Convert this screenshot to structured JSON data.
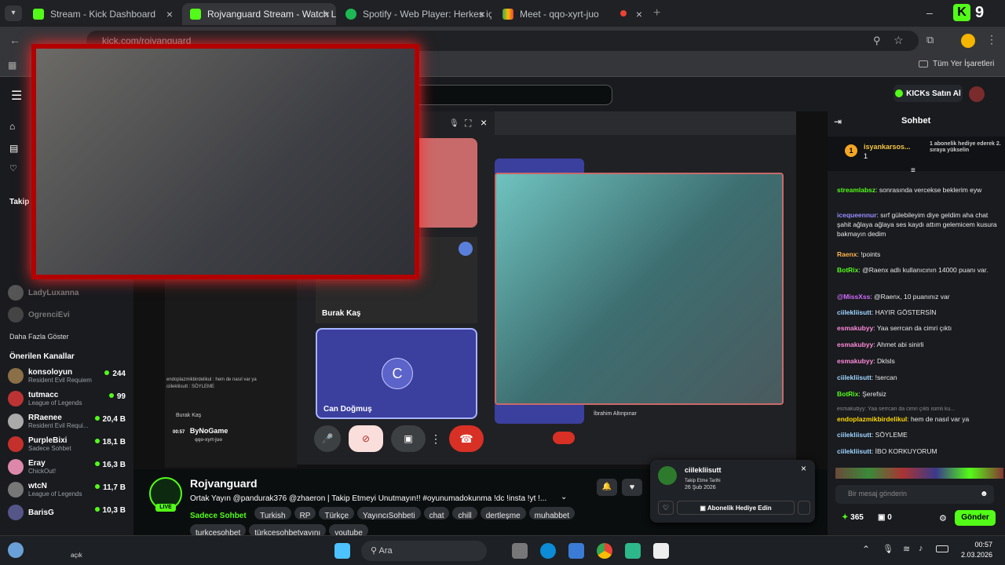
{
  "browser": {
    "tabs": [
      {
        "title": "Stream - Kick Dashboard",
        "color": "#53fc18",
        "active": false
      },
      {
        "title": "Rojvanguard Stream - Watch Li",
        "color": "#53fc18",
        "active": true
      },
      {
        "title": "Spotify - Web Player: Herkes için",
        "color": "#1db954",
        "active": false
      },
      {
        "title": "Meet - qqo-xyrt-juo",
        "color": "#34a853",
        "active": false
      }
    ],
    "url": "kick.com/rojvanguard",
    "bookmarks_label": "Tüm Yer İşaretleri",
    "kick_badge_count": "9"
  },
  "kick_nav": {
    "buy_kicks": "KICKs Satın Al"
  },
  "sidebar": {
    "following_label": "Takip",
    "followed": [
      {
        "name": "LadyLuxanna"
      },
      {
        "name": "OgrenciEvi"
      }
    ],
    "show_more": "Daha Fazla Göster",
    "recommended_title": "Önerilen Kanallar",
    "recommended": [
      {
        "name": "konsoloyun",
        "game": "Resident Evil Requiem",
        "viewers": "244",
        "color": "#8b6f47"
      },
      {
        "name": "tutmacc",
        "game": "League of Legends",
        "viewers": "99",
        "color": "#b33"
      },
      {
        "name": "RRaenee",
        "game": "Resident Evil Requi...",
        "viewers": "20,4 B",
        "color": "#aaa"
      },
      {
        "name": "PurpleBixi",
        "game": "Sadece Sohbet",
        "viewers": "18,1 B",
        "color": "#c4302b"
      },
      {
        "name": "Eray",
        "game": "ChickOut!",
        "viewers": "16,3 B",
        "color": "#d8a"
      },
      {
        "name": "wtcN",
        "game": "League of Legends",
        "viewers": "11,7 B",
        "color": "#777"
      },
      {
        "name": "BarisG",
        "game": "",
        "viewers": "10,3 B",
        "color": "#558"
      }
    ]
  },
  "call": {
    "participant_1": "Burak Kaş",
    "participant_2": "Can Doğmuş",
    "participant_2_initial": "C",
    "participant_3": "İbrahim Altınpınar",
    "mini_label": "Burak Kaş",
    "chat_overlay_1": "endoplazmikbirdelikul : hem de nasıl var ya",
    "chat_overlay_2": "ciilekliisutt : SÖYLEME",
    "watermark": "ByNoGame",
    "watermark_sub": "qqo-xyrt-juo",
    "clock": "00:57"
  },
  "channel": {
    "name": "Rojvanguard",
    "live_label": "LIVE",
    "title": "Ortak Yayın @pandurak376 @zhaeron | Takip Etmeyi Unutmayın!! #oyunumadokunma !dc !insta !yt !...",
    "category": "Sadece Sohbet",
    "tags": [
      "Turkish",
      "RP",
      "Türkçe",
      "YayıncıSohbeti",
      "chat",
      "chill",
      "dertleşme",
      "muhabbet",
      "turkçesohbet",
      "türkçesohbetyayını",
      "youtube"
    ]
  },
  "follow_popup": {
    "user": "ciilekliisutt",
    "label": "Takip Etme Tarihi",
    "date": "26 Şub 2026",
    "gift_button": "Abonelik Hediye Edin"
  },
  "chat": {
    "title": "Sohbet",
    "pinned_user": "isyankarsos...",
    "pinned_count": "1",
    "pinned_text": "1 abonelik hediye ederek 2. sıraya yükselin",
    "messages": [
      {
        "user": "streamlabsz",
        "color": "#53fc18",
        "text": "sonrasında vercekse beklerim eyw"
      },
      {
        "user": "icequeennur",
        "color": "#9b8cff",
        "text": "sırf gülebileyim diye geldim aha chat şahit ağlaya ağlaya ses kaydı attım gelemicem kusura bakmayın dedim"
      },
      {
        "user": "Raenx",
        "color": "#ffb347",
        "text": "!points"
      },
      {
        "user": "BotRix",
        "color": "#53fc18",
        "text": "@Raenx adlı kullanıcının 14000 puanı var."
      },
      {
        "user": "@MissXss",
        "color": "#d16cff",
        "text": "@Raenx, 10 puanınız var"
      },
      {
        "user": "ciilekliisutt",
        "color": "#9fd4ff",
        "text": "HAYIR GÖSTERSİN"
      },
      {
        "user": "esmakubyy",
        "color": "#ff8ad8",
        "text": "Yaa serrcan da cimri çıktı"
      },
      {
        "user": "esmakubyy",
        "color": "#ff8ad8",
        "text": "Ahmet abi sinirli"
      },
      {
        "user": "esmakubyy",
        "color": "#ff8ad8",
        "text": "Dklsls"
      },
      {
        "user": "ciilekliisutt",
        "color": "#9fd4ff",
        "text": "!sercan"
      },
      {
        "user": "BotRix",
        "color": "#53fc18",
        "text": "Şerefsiz"
      },
      {
        "user": "endoplazmikbirdelikul",
        "color": "#ffd700",
        "text": "hem de nasıl var ya"
      },
      {
        "user": "ciilekliisutt",
        "color": "#9fd4ff",
        "text": "SÖYLEME"
      },
      {
        "user": "ciilekliisutt",
        "color": "#9fd4ff",
        "text": "İBO KORKUYORUM"
      }
    ],
    "reply_hint": "esmakubyy: Yaa serrcan da cimri çıktı isimli ku...",
    "input_placeholder": "Bir mesaj gönderin",
    "points": "365",
    "gifts": "0",
    "send_label": "Gönder"
  },
  "taskbar": {
    "search_placeholder": "Ara",
    "time": "00:57",
    "date": "2.03.2026",
    "weather_hint": "açık"
  },
  "colors": {
    "kick_green": "#53fc18",
    "bg": "#0b0e0f",
    "panel": "#191b1f"
  }
}
